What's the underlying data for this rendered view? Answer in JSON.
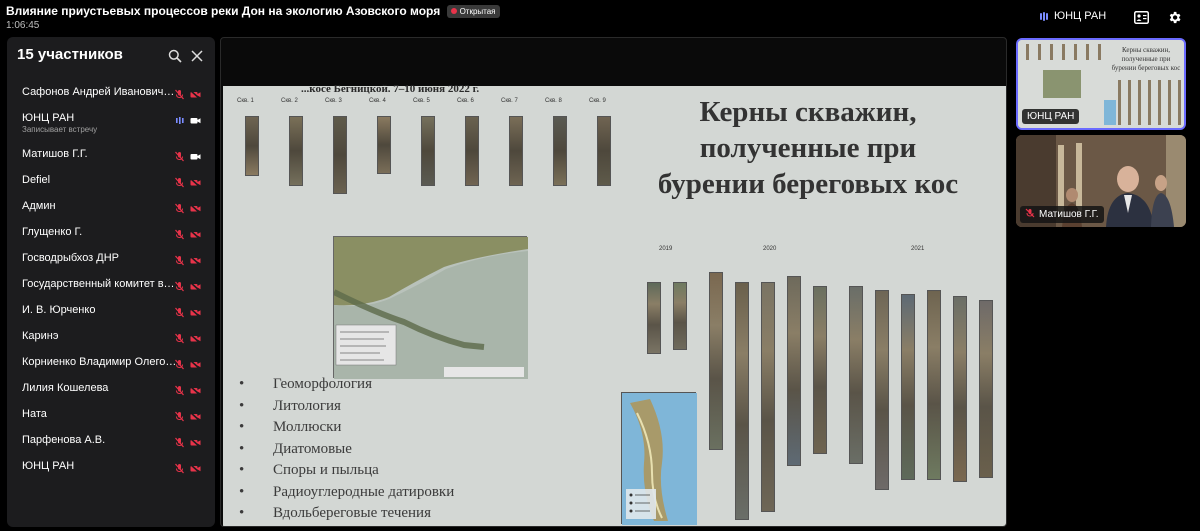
{
  "header": {
    "title": "Влияние приустьевых процессов реки Дон на экологию Азовского моря",
    "badge": "Открытая",
    "timer": "1:06:45",
    "host_label": "ЮНЦ РАН"
  },
  "participants": {
    "title": "15 участников",
    "list": [
      {
        "name": "Сафонов Андрей Иванович (СЯ)",
        "mic": "muted",
        "cam": "off"
      },
      {
        "name": "ЮНЦ РАН",
        "sub": "Записывает встречу",
        "mic": "active",
        "cam": "on"
      },
      {
        "name": "Матишов Г.Г.",
        "mic": "muted",
        "cam": "on"
      },
      {
        "name": "Defiel",
        "mic": "muted",
        "cam": "off"
      },
      {
        "name": "Админ",
        "mic": "muted",
        "cam": "off"
      },
      {
        "name": "Глущенко Г.",
        "mic": "muted",
        "cam": "off"
      },
      {
        "name": "Госводрыбхоз ДНР",
        "mic": "muted",
        "cam": "off"
      },
      {
        "name": "Государственный комитет водного хозяйства",
        "mic": "muted",
        "cam": "off"
      },
      {
        "name": "И. В. Юрченко",
        "mic": "muted",
        "cam": "off"
      },
      {
        "name": "Каринэ",
        "mic": "muted",
        "cam": "off"
      },
      {
        "name": "Корниенко Владимир Олегович",
        "mic": "muted",
        "cam": "off"
      },
      {
        "name": "Лилия Кошелева",
        "mic": "muted",
        "cam": "off"
      },
      {
        "name": "Ната",
        "mic": "muted",
        "cam": "off"
      },
      {
        "name": "Парфенова А.В.",
        "mic": "muted",
        "cam": "off"
      },
      {
        "name": "ЮНЦ РАН",
        "mic": "muted",
        "cam": "off"
      }
    ]
  },
  "slide": {
    "top_text": "...косе Бегницкой. 7–10 июня 2022 г.",
    "title": "Керны скважин, полученные при бурении береговых кос",
    "bullets": [
      "Геоморфология",
      "Литология",
      "Моллюски",
      "Диатомовые",
      "Споры и пыльца",
      "Радиоуглеродные датировки",
      "Вдольбереговые течения"
    ],
    "core_labels": [
      "Скв. 1",
      "Скв. 2",
      "Скв. 3",
      "Скв. 4",
      "Скв. 5",
      "Скв. 6",
      "Скв. 7",
      "Скв. 8",
      "Скв. 9"
    ],
    "years": [
      "2019",
      "2020",
      "2021"
    ]
  },
  "thumbnails": [
    {
      "label": "ЮНЦ РАН"
    },
    {
      "label": "Матишов Г.Г."
    }
  ],
  "colors": {
    "accent": "#6b6bff",
    "muted_red": "#e8334a",
    "panel_bg": "#1c1c1e",
    "slide_bg": "#d3d7d4"
  }
}
